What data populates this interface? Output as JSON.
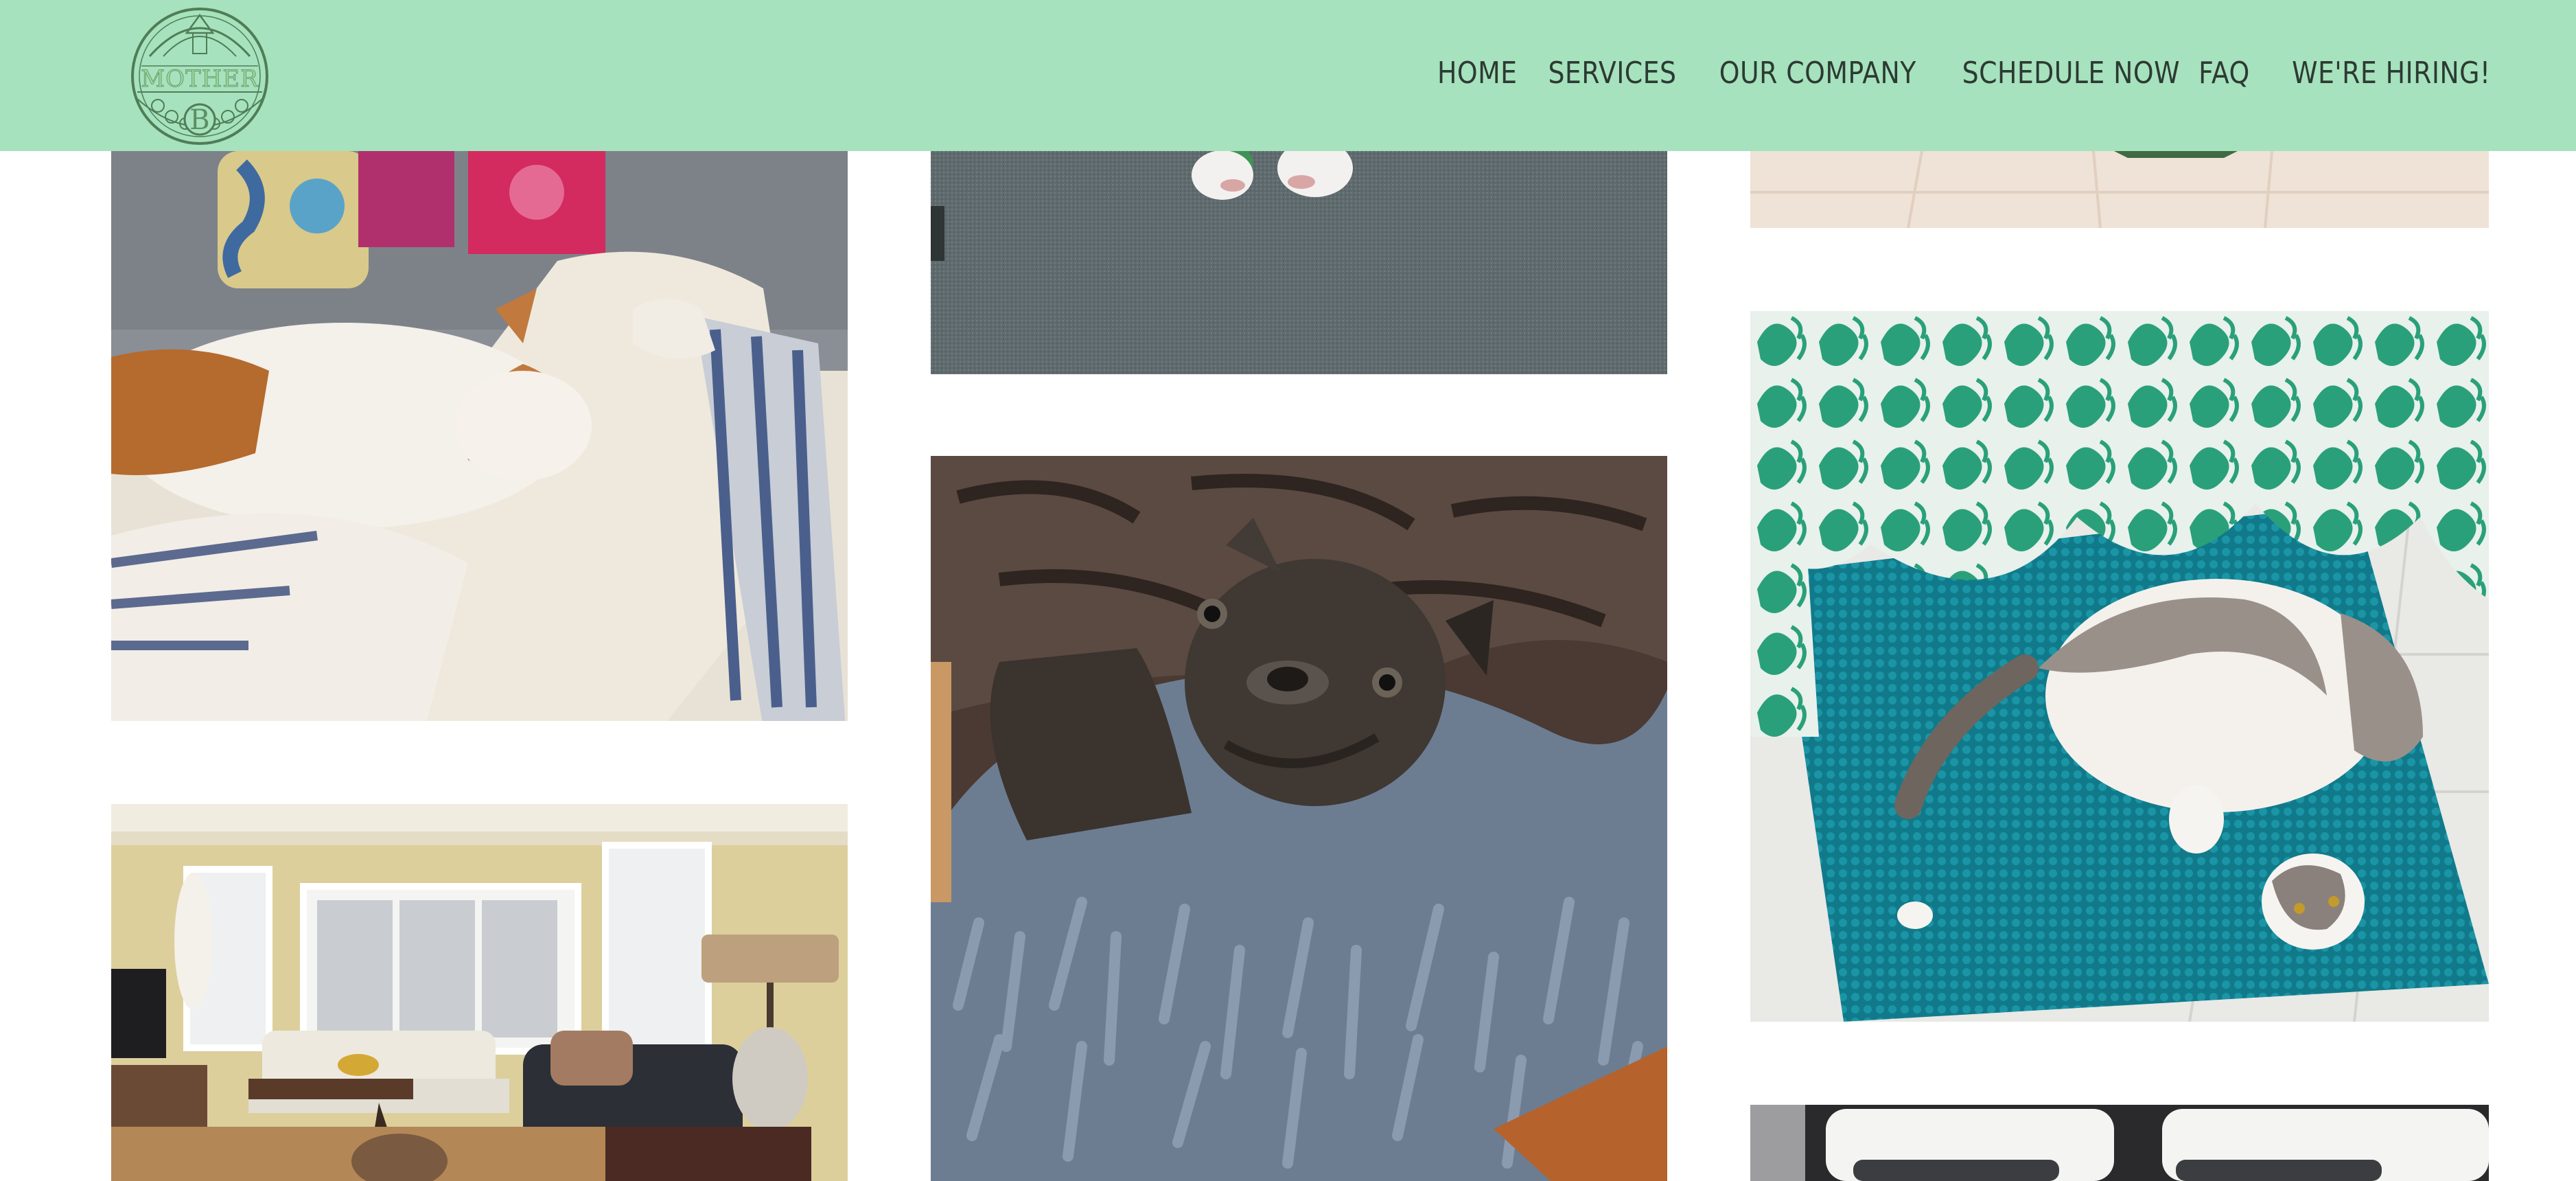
{
  "header": {
    "logo": {
      "wordmark": "MOTHER",
      "monogram": "B",
      "icon": "circular-emblem-logo"
    },
    "nav": {
      "items": [
        {
          "label": "HOME"
        },
        {
          "label": "SERVICES"
        },
        {
          "label": "OUR COMPANY"
        },
        {
          "label": "SCHEDULE NOW"
        },
        {
          "label": "FAQ"
        },
        {
          "label": "WE'RE HIRING!"
        }
      ]
    }
  },
  "gallery": {
    "photos": [
      {
        "subject": "dog-sleeping-on-couch-photo"
      },
      {
        "subject": "living-room-photo"
      },
      {
        "subject": "cat-paw-on-gray-carpet-photo"
      },
      {
        "subject": "french-bulldog-on-fluffy-blanket-photo"
      },
      {
        "subject": "bedspread-photo"
      },
      {
        "subject": "cat-lying-on-teal-bathmat-photo"
      },
      {
        "subject": "bed-with-pillows-photo"
      }
    ]
  },
  "colors": {
    "header_background": "#a6e2bd",
    "nav_text": "#2d3a33",
    "page_background": "#ffffff"
  }
}
